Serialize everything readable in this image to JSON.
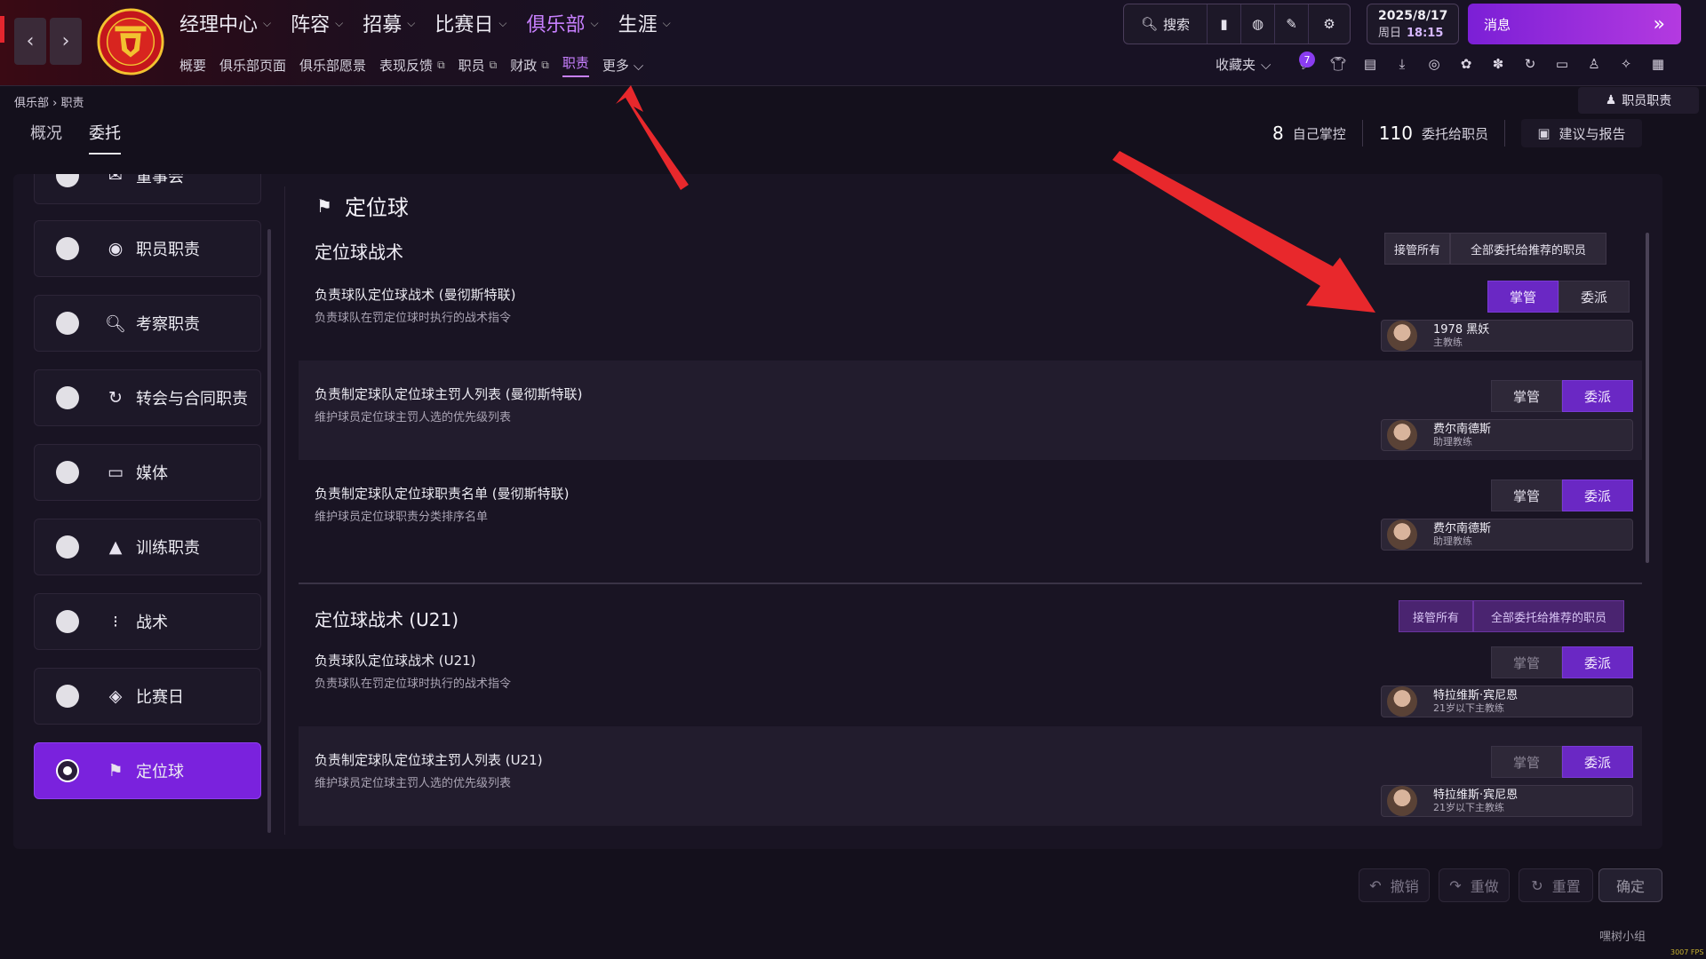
{
  "header": {
    "main_nav": [
      {
        "label": "经理中心",
        "active": false
      },
      {
        "label": "阵容",
        "active": false
      },
      {
        "label": "招募",
        "active": false
      },
      {
        "label": "比赛日",
        "active": false
      },
      {
        "label": "俱乐部",
        "active": true
      },
      {
        "label": "生涯",
        "active": false
      }
    ],
    "sub_nav": [
      {
        "label": "概要",
        "ext": false,
        "active": false
      },
      {
        "label": "俱乐部页面",
        "ext": false,
        "active": false
      },
      {
        "label": "俱乐部愿景",
        "ext": false,
        "active": false
      },
      {
        "label": "表现反馈",
        "ext": true,
        "active": false
      },
      {
        "label": "职员",
        "ext": true,
        "active": false
      },
      {
        "label": "财政",
        "ext": true,
        "active": false
      },
      {
        "label": "职责",
        "ext": false,
        "active": true
      },
      {
        "label": "更多",
        "ext": false,
        "active": false
      }
    ],
    "search_label": "搜索",
    "date": "2025/8/17",
    "weekday": "周日",
    "time": "18:15",
    "messages_label": "消息",
    "favorites_label": "收藏夹",
    "notification_count": "7"
  },
  "breadcrumb": {
    "root": "俱乐部",
    "current": "职责"
  },
  "staff_duty_button": "职员职责",
  "tabs": [
    {
      "label": "概况",
      "active": false
    },
    {
      "label": "委托",
      "active": true
    }
  ],
  "stats": {
    "self_count": "8",
    "self_label": "自己掌控",
    "delegated_count": "110",
    "delegated_label": "委托给职员",
    "advice_label": "建议与报告"
  },
  "sidebar": [
    {
      "label": "董事会",
      "icon": "mail-icon"
    },
    {
      "label": "职员职责",
      "icon": "person-icon"
    },
    {
      "label": "考察职责",
      "icon": "search-icon"
    },
    {
      "label": "转会与合同职责",
      "icon": "refresh-icon"
    },
    {
      "label": "媒体",
      "icon": "monitor-icon"
    },
    {
      "label": "训练职责",
      "icon": "cone-icon"
    },
    {
      "label": "战术",
      "icon": "tactics-icon"
    },
    {
      "label": "比赛日",
      "icon": "ticket-icon"
    },
    {
      "label": "定位球",
      "icon": "corner-flag-icon",
      "active": true
    }
  ],
  "content": {
    "title": "定位球",
    "take_all_label": "接管所有",
    "delegate_all_label": "全部委托给推荐的职员",
    "control_label": "掌管",
    "delegate_label": "委派",
    "sections": [
      {
        "heading": "定位球战术",
        "rows": [
          {
            "title": "负责球队定位球战术 (曼彻斯特联)",
            "desc": "负责球队在罚定位球时执行的战术指令",
            "mode": "control",
            "staff_name": "1978 黑妖",
            "staff_role": "主教练"
          },
          {
            "title": "负责制定球队定位球主罚人列表 (曼彻斯特联)",
            "desc": "维护球员定位球主罚人选的优先级列表",
            "mode": "delegate",
            "staff_name": "费尔南德斯",
            "staff_role": "助理教练"
          },
          {
            "title": "负责制定球队定位球职责名单 (曼彻斯特联)",
            "desc": "维护球员定位球职责分类排序名单",
            "mode": "delegate",
            "staff_name": "费尔南德斯",
            "staff_role": "助理教练"
          }
        ]
      },
      {
        "heading": "定位球战术 (U21)",
        "rows": [
          {
            "title": "负责球队定位球战术 (U21)",
            "desc": "负责球队在罚定位球时执行的战术指令",
            "mode": "delegate",
            "staff_name": "特拉维斯·宾尼恩",
            "staff_role": "21岁以下主教练"
          },
          {
            "title": "负责制定球队定位球主罚人列表 (U21)",
            "desc": "维护球员定位球主罚人选的优先级列表",
            "mode": "delegate",
            "staff_name": "特拉维斯·宾尼恩",
            "staff_role": "21岁以下主教练"
          }
        ]
      }
    ]
  },
  "actions": {
    "undo": "撤销",
    "redo": "重做",
    "reset": "重置",
    "confirm": "确定"
  },
  "watermark": "嘿树小组",
  "fps": "3007 FPS",
  "colors": {
    "accent": "#7a22dd",
    "annotation": "#e8282c"
  }
}
